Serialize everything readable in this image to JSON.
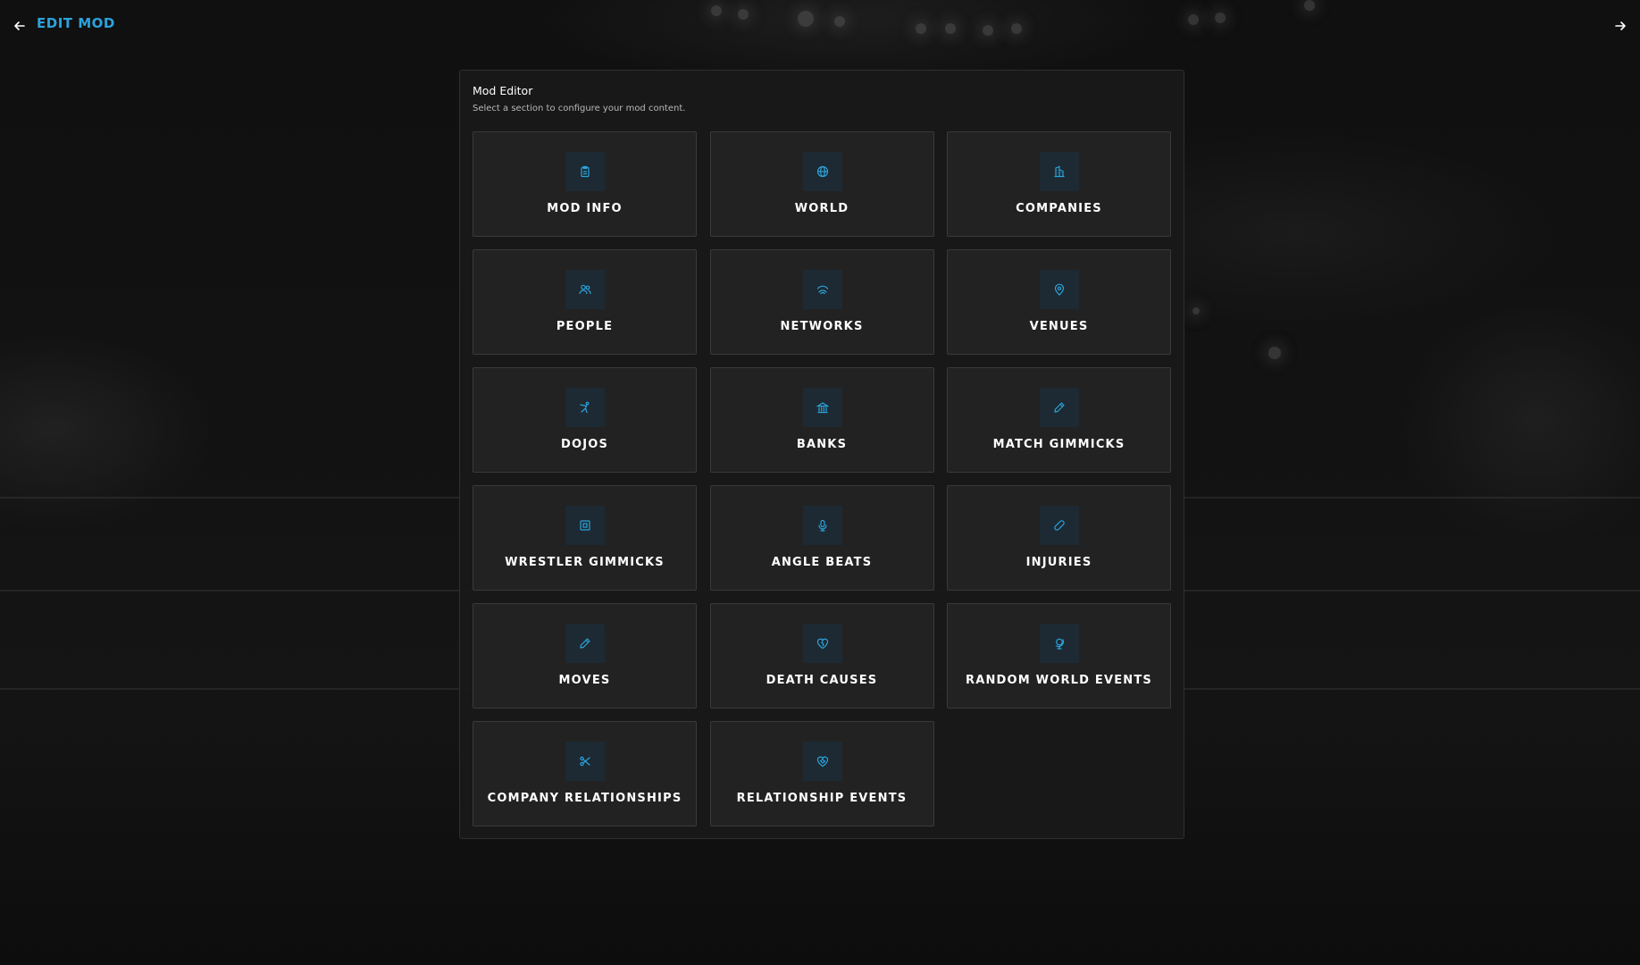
{
  "header": {
    "title": "EDIT MOD",
    "back_icon": "arrow-left-icon",
    "forward_icon": "arrow-right-icon"
  },
  "panel": {
    "title": "Mod Editor",
    "subtitle": "Select a section to configure your mod content."
  },
  "colors": {
    "accent": "#2ba3dc",
    "tile_bg": "#222222",
    "icon_bg": "#1d2a33",
    "panel_bg": "#181818"
  },
  "sections": [
    {
      "label": "MOD INFO",
      "icon": "clipboard-icon"
    },
    {
      "label": "WORLD",
      "icon": "globe-icon"
    },
    {
      "label": "COMPANIES",
      "icon": "building-icon"
    },
    {
      "label": "PEOPLE",
      "icon": "users-icon"
    },
    {
      "label": "NETWORKS",
      "icon": "broadcast-icon"
    },
    {
      "label": "VENUES",
      "icon": "map-pin-icon"
    },
    {
      "label": "DOJOS",
      "icon": "kick-icon"
    },
    {
      "label": "BANKS",
      "icon": "bank-icon"
    },
    {
      "label": "MATCH GIMMICKS",
      "icon": "pencil-icon"
    },
    {
      "label": "WRESTLER GIMMICKS",
      "icon": "square-target-icon"
    },
    {
      "label": "ANGLE BEATS",
      "icon": "microphone-icon"
    },
    {
      "label": "INJURIES",
      "icon": "bandage-icon"
    },
    {
      "label": "MOVES",
      "icon": "pencil-icon"
    },
    {
      "label": "DEATH CAUSES",
      "icon": "heart-crack-icon"
    },
    {
      "label": "RANDOM WORLD EVENTS",
      "icon": "globe-stand-icon"
    },
    {
      "label": "COMPANY RELATIONSHIPS",
      "icon": "scissors-icon"
    },
    {
      "label": "RELATIONSHIP EVENTS",
      "icon": "heart-handshake-icon"
    }
  ]
}
